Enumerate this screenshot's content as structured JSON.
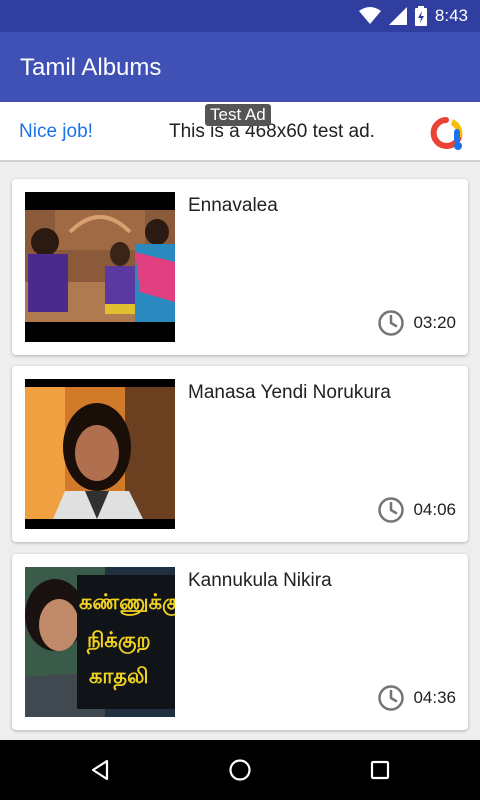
{
  "status_bar": {
    "time": "8:43",
    "icons": [
      "wifi-icon",
      "signal-icon",
      "battery-icon"
    ]
  },
  "app_bar": {
    "title": "Tamil Albums"
  },
  "ad": {
    "nice_label": "Nice job!",
    "text": "This is a 468x60 test ad.",
    "tag": "Test Ad"
  },
  "songs": [
    {
      "title": "Ennavalea",
      "duration": "03:20"
    },
    {
      "title": "Manasa Yendi Norukura",
      "duration": "04:06"
    },
    {
      "title": "Kannukula Nikira",
      "duration": "04:36"
    }
  ],
  "thumb3_text": [
    "கண்ணுக்கு",
    "நிக்குற",
    "காதலி"
  ],
  "colors": {
    "primary": "#3f51b5",
    "primary_dark": "#303f9f",
    "background": "#eeeeee"
  }
}
